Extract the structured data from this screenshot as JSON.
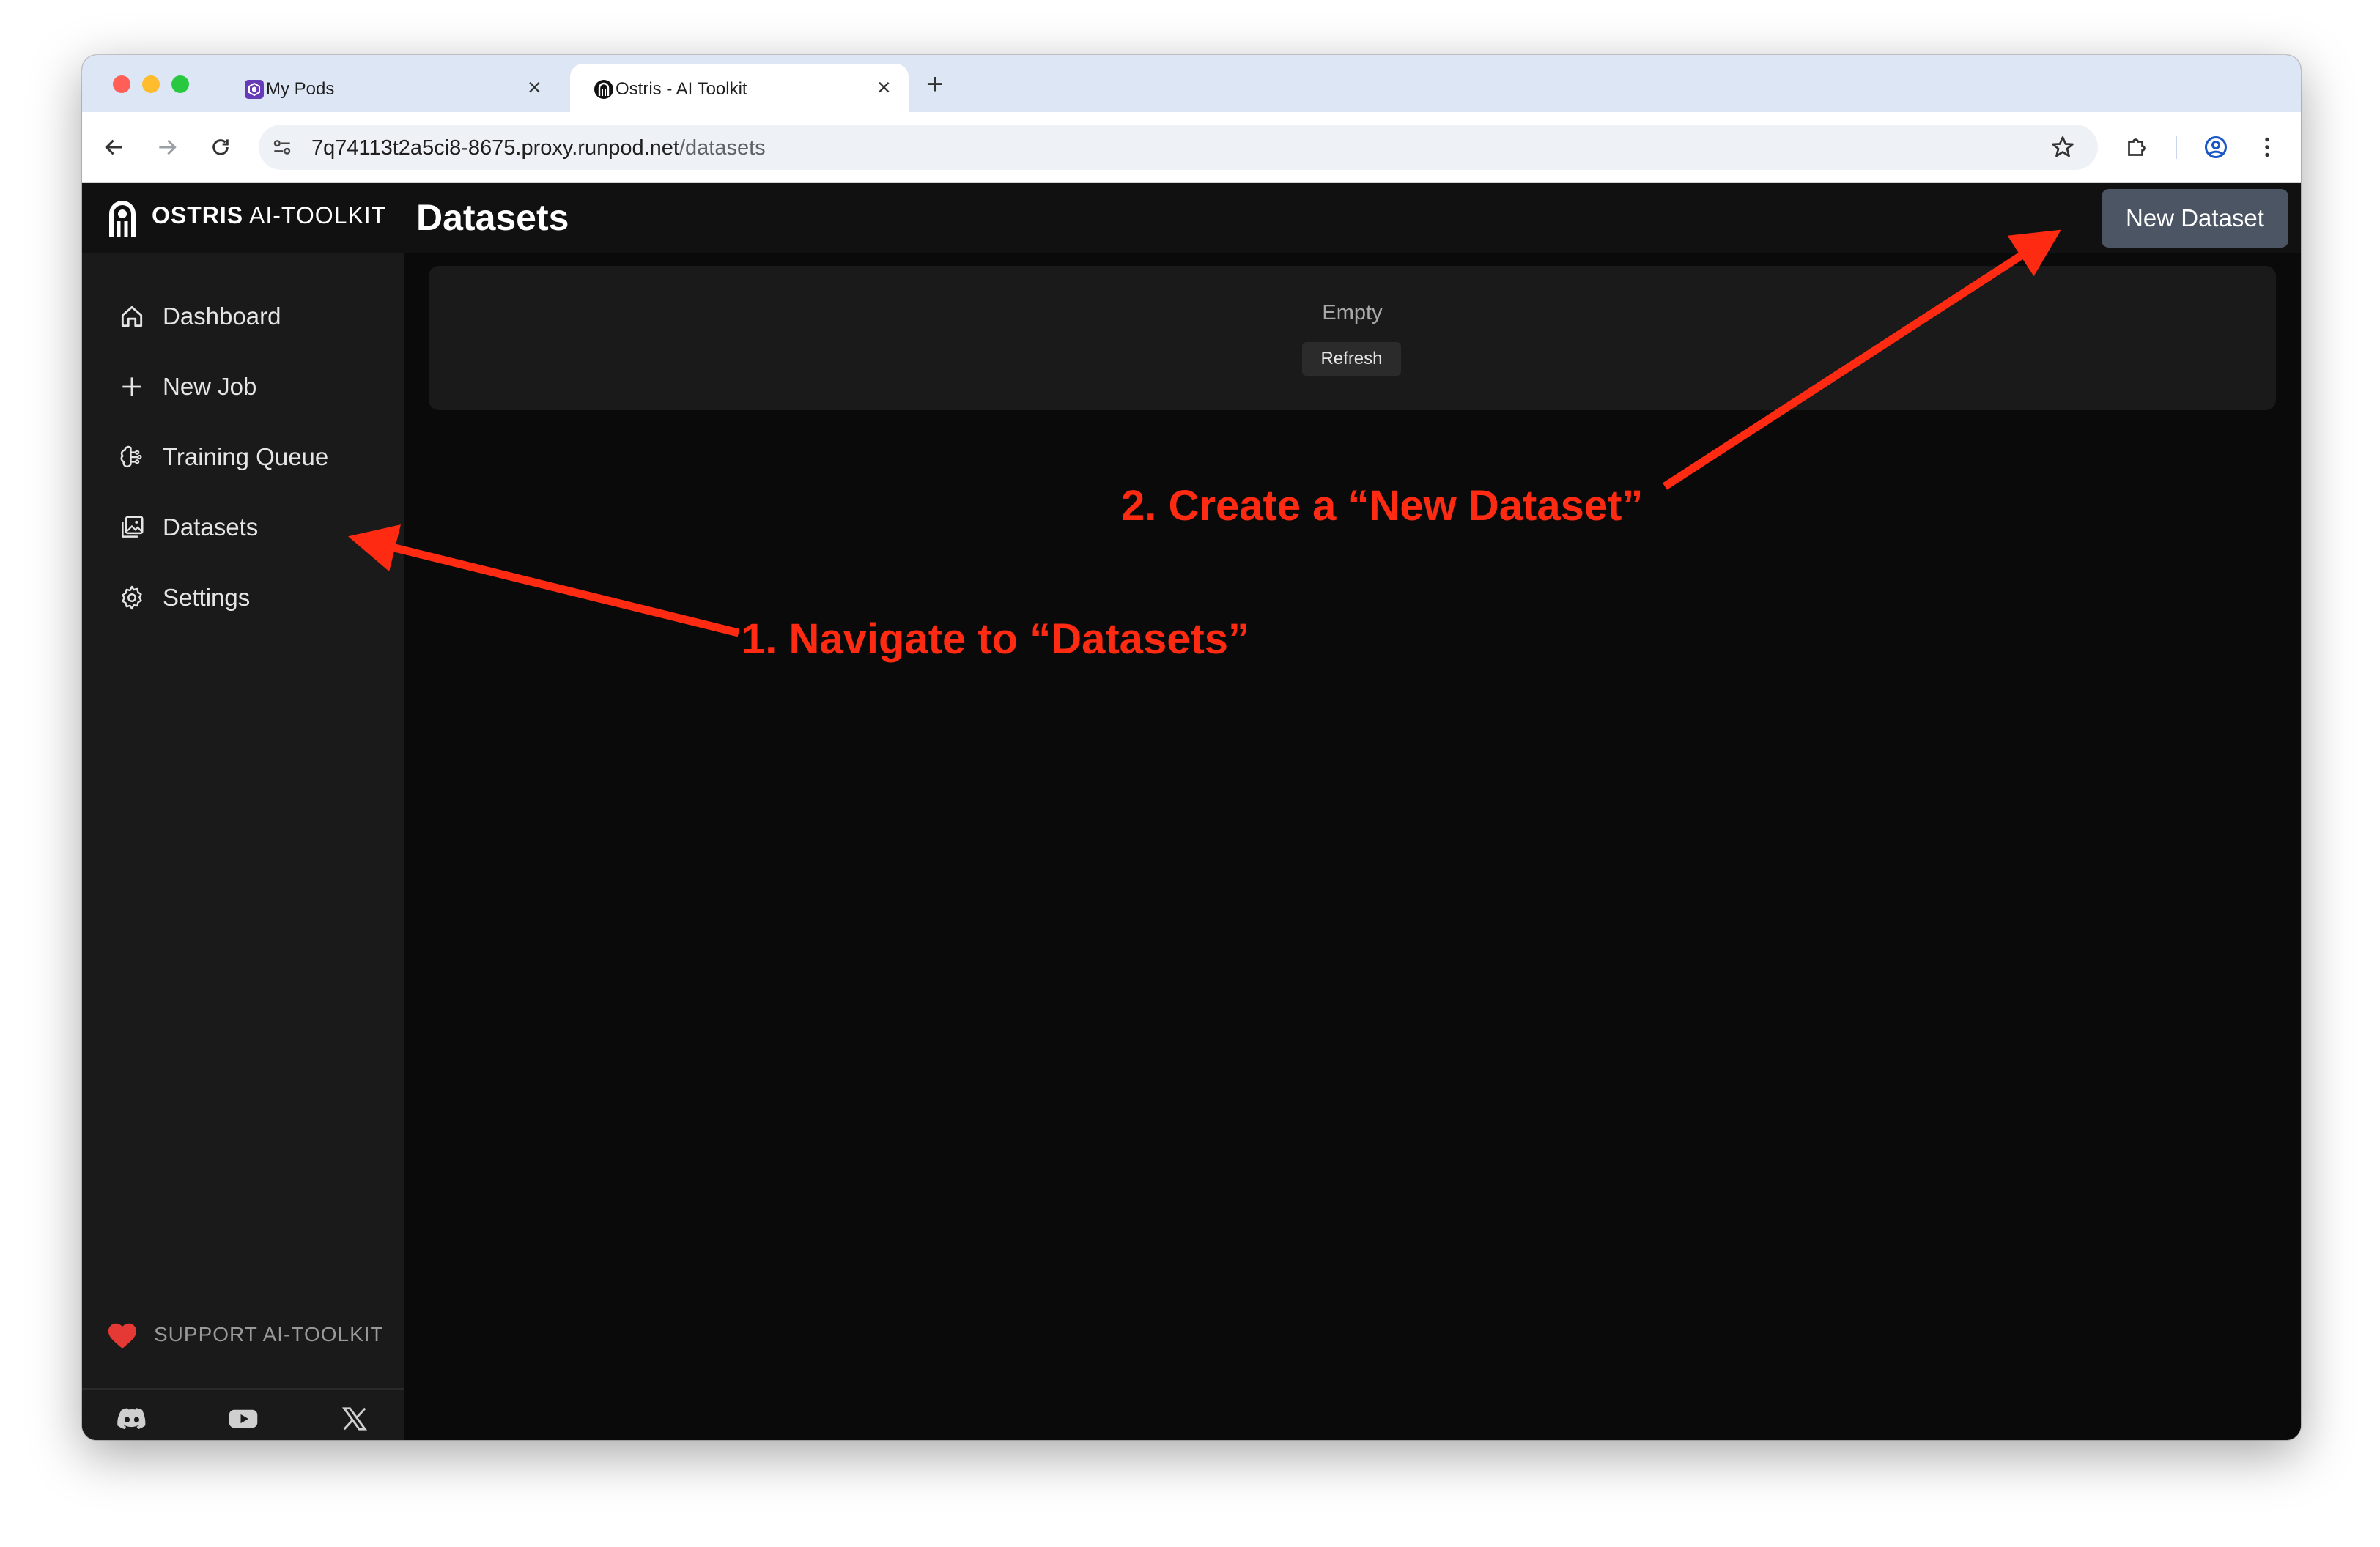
{
  "browser": {
    "tabs": [
      {
        "label": "My Pods",
        "close": "×",
        "active": false,
        "icon": "runpod-icon"
      },
      {
        "label": "Ostris - AI Toolkit",
        "close": "×",
        "active": true,
        "icon": "ostris-icon"
      }
    ],
    "new_tab": "+",
    "url_host": "7q74113t2a5ci8-8675.proxy.runpod.net",
    "url_path": "/datasets"
  },
  "app": {
    "brand_name": "OSTRIS",
    "brand_product": "AI-TOOLKIT",
    "page_title": "Datasets",
    "new_dataset_label": "New Dataset",
    "sidebar": {
      "items": [
        {
          "label": "Dashboard",
          "icon": "home-icon"
        },
        {
          "label": "New Job",
          "icon": "plus-icon"
        },
        {
          "label": "Training Queue",
          "icon": "brain-icon"
        },
        {
          "label": "Datasets",
          "icon": "image-stack-icon"
        },
        {
          "label": "Settings",
          "icon": "gear-icon"
        }
      ],
      "support_label": "SUPPORT AI-TOOLKIT",
      "social": [
        "discord-icon",
        "youtube-icon",
        "x-icon"
      ]
    },
    "content": {
      "empty_text": "Empty",
      "refresh_label": "Refresh"
    }
  },
  "annotations": {
    "step1": "1. Navigate to “Datasets”",
    "step2": "2. Create a “New Dataset”",
    "color": "#ff2a12"
  },
  "colors": {
    "accent_button": "#4b5563",
    "heart": "#e53935",
    "tabbar": "#dde6f5"
  }
}
